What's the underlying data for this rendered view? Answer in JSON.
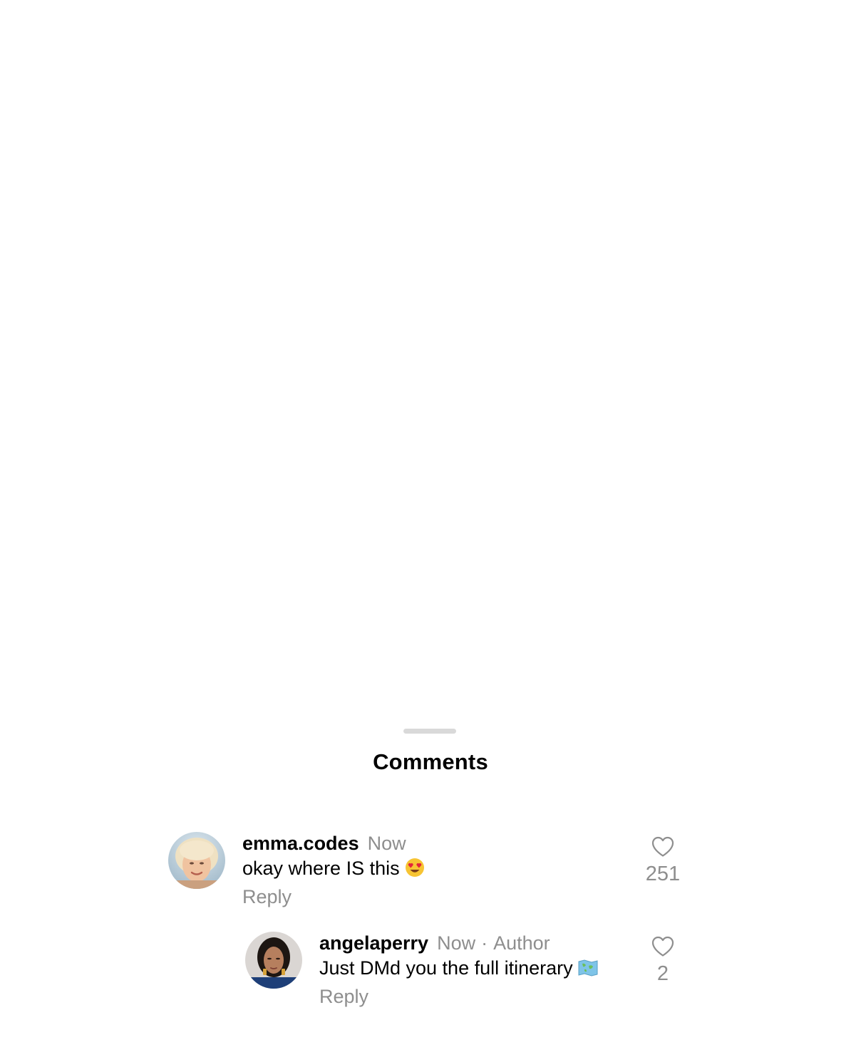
{
  "sheet": {
    "title": "Comments"
  },
  "comments": [
    {
      "username": "emma.codes",
      "time": "Now",
      "text": "okay where IS this",
      "emoji": "smiling-face-with-heart-eyes",
      "reply_label": "Reply",
      "likes": "251"
    },
    {
      "username": "angelaperry",
      "time": "Now",
      "separator": "·",
      "badge": "Author",
      "text": "Just DMd you the full itinerary",
      "emoji": "world-map",
      "reply_label": "Reply",
      "likes": "2"
    }
  ],
  "colors": {
    "muted": "#8e8e8e",
    "grabber": "#d9d9d9",
    "text": "#000000"
  }
}
